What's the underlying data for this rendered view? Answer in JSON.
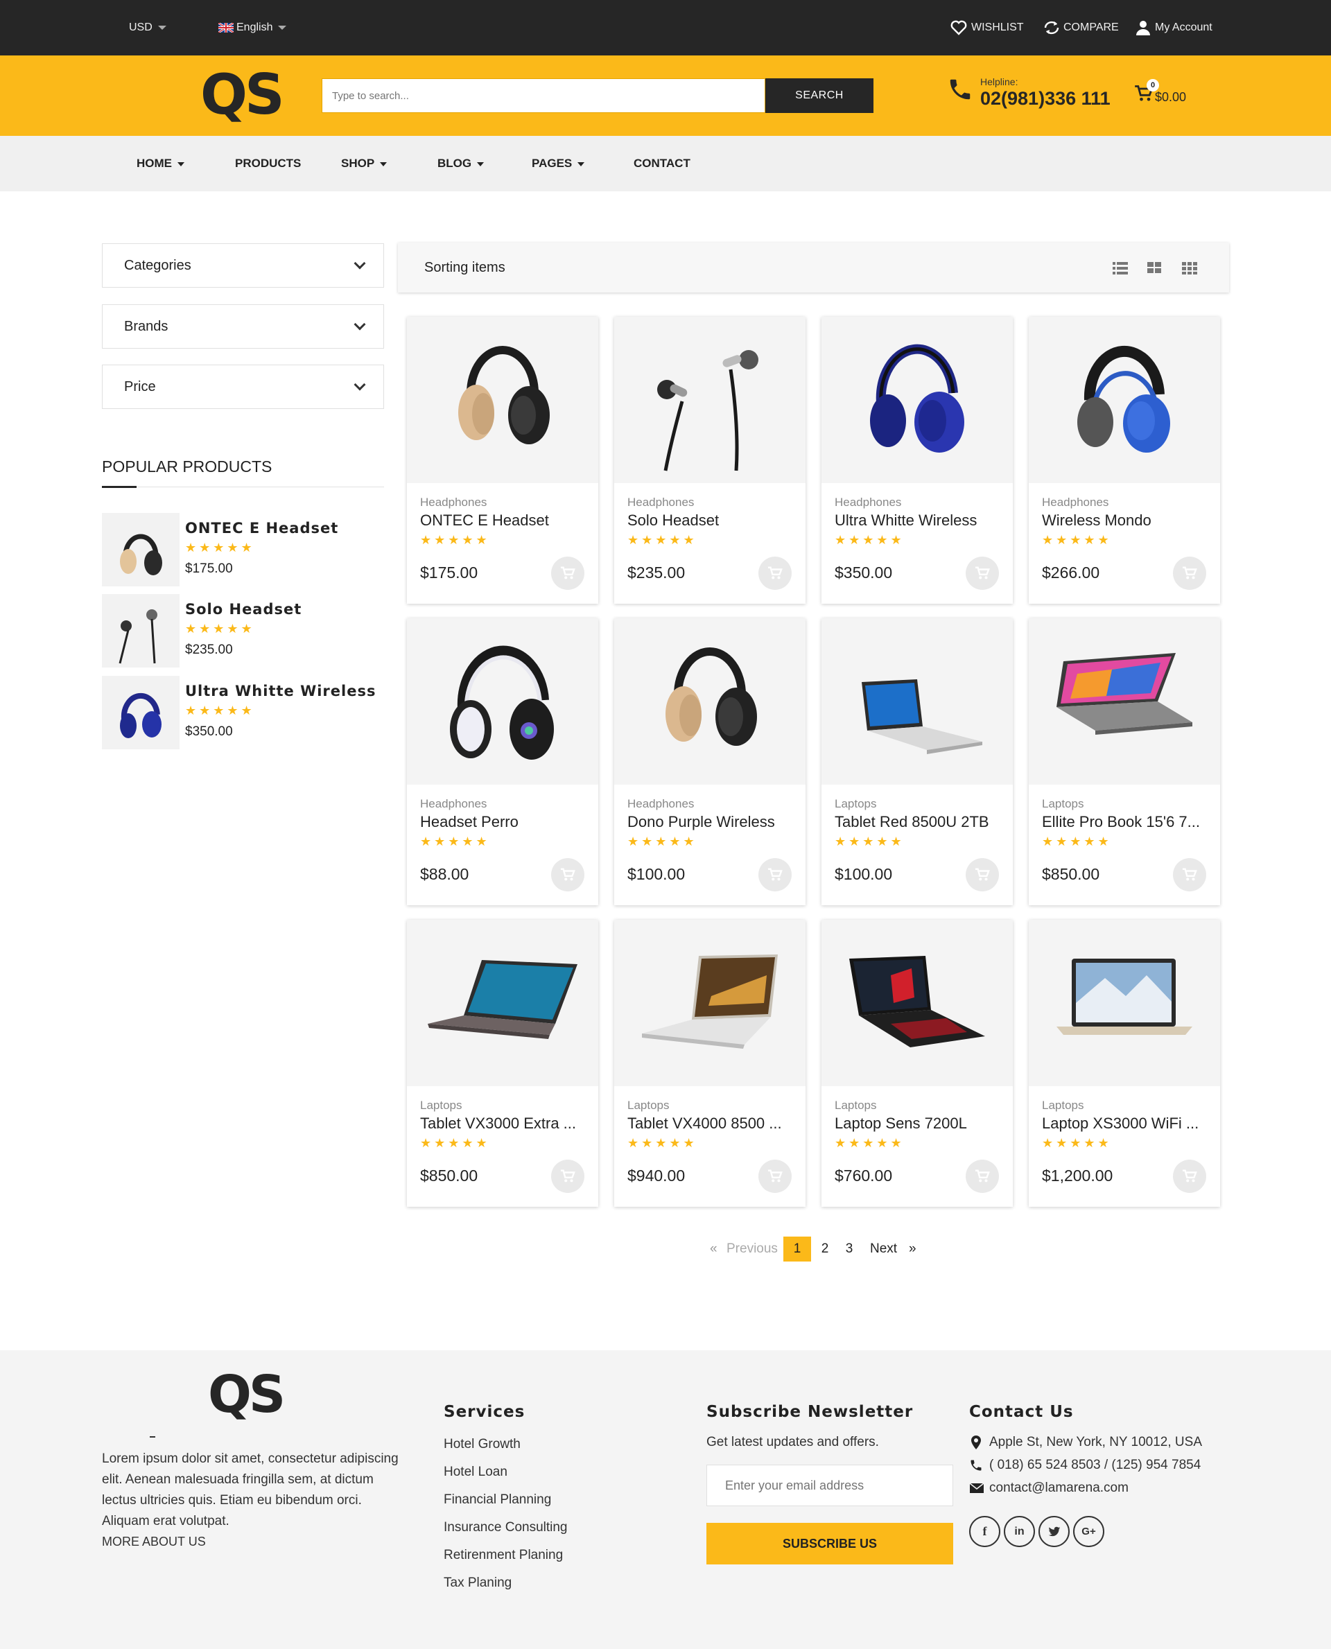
{
  "topbar": {
    "currency": "USD",
    "language": "English",
    "wishlist": "WISHLIST",
    "compare": "COMPARE",
    "account": "My Account"
  },
  "header": {
    "logo": "QS",
    "search_placeholder": "Type to search...",
    "search_button": "SEARCH",
    "helpline_label": "Helpline:",
    "helpline_number": "02(981)336 111",
    "cart_count": "0",
    "cart_total": "$0.00"
  },
  "nav": {
    "items": [
      {
        "label": "HOME"
      },
      {
        "label": "PRODUCTS"
      },
      {
        "label": "SHOP"
      },
      {
        "label": "BLOG"
      },
      {
        "label": "PAGES"
      },
      {
        "label": "CONTACT"
      }
    ]
  },
  "sidebar": {
    "filters": [
      "Categories",
      "Brands",
      "Price"
    ],
    "popular_title": "POPULAR PRODUCTS",
    "popular": [
      {
        "name": "ONTEC E Headset",
        "price": "$175.00",
        "stars": "★★★★★"
      },
      {
        "name": "Solo Headset",
        "price": "$235.00",
        "stars": "★★★★★"
      },
      {
        "name": "Ultra Whitte Wireless",
        "price": "$350.00",
        "stars": "★★★★★"
      }
    ]
  },
  "sortbar": {
    "label": "Sorting items"
  },
  "products": [
    {
      "category": "Headphones",
      "title": "ONTEC E Headset",
      "price": "$175.00",
      "stars": "★★★★★"
    },
    {
      "category": "Headphones",
      "title": "Solo Headset",
      "price": "$235.00",
      "stars": "★★★★★"
    },
    {
      "category": "Headphones",
      "title": "Ultra Whitte Wireless",
      "price": "$350.00",
      "stars": "★★★★★"
    },
    {
      "category": "Headphones",
      "title": "Wireless Mondo",
      "price": "$266.00",
      "stars": "★★★★★"
    },
    {
      "category": "Headphones",
      "title": "Headset Perro",
      "price": "$88.00",
      "stars": "★★★★★"
    },
    {
      "category": "Headphones",
      "title": "Dono Purple Wireless",
      "price": "$100.00",
      "stars": "★★★★★"
    },
    {
      "category": "Laptops",
      "title": "Tablet Red 8500U 2TB",
      "price": "$100.00",
      "stars": "★★★★★"
    },
    {
      "category": "Laptops",
      "title": "Ellite Pro Book 15'6 7...",
      "price": "$850.00",
      "stars": "★★★★★"
    },
    {
      "category": "Laptops",
      "title": "Tablet VX3000 Extra ...",
      "price": "$850.00",
      "stars": "★★★★★"
    },
    {
      "category": "Laptops",
      "title": "Tablet VX4000 8500 ...",
      "price": "$940.00",
      "stars": "★★★★★"
    },
    {
      "category": "Laptops",
      "title": "Laptop Sens 7200L",
      "price": "$760.00",
      "stars": "★★★★★"
    },
    {
      "category": "Laptops",
      "title": "Laptop XS3000 WiFi ...",
      "price": "$1,200.00",
      "stars": "★★★★★"
    }
  ],
  "pagination": {
    "prev_arrow": "«",
    "previous": "Previous",
    "pages": [
      "1",
      "2",
      "3"
    ],
    "current": "1",
    "next": "Next",
    "next_arrow": "»"
  },
  "footer": {
    "logo": "QS",
    "about_lines": [
      "Lorem ipsum dolor sit amet, consectetur adipiscing",
      "elit. Aenean malesuada fringilla sem, at dictum",
      "lectus ultricies quis. Etiam eu bibendum orci.",
      "Aliquam erat volutpat."
    ],
    "more_about": "MORE ABOUT US",
    "services_title": "Services",
    "services": [
      "Hotel Growth",
      "Hotel Loan",
      "Financial Planning",
      "Insurance Consulting",
      "Retirenment Planing",
      "Tax Planing"
    ],
    "newsletter_title": "Subscribe Newsletter",
    "newsletter_text": "Get latest updates and offers.",
    "email_placeholder": "Enter your email address",
    "subscribe_button": "SUBSCRIBE US",
    "contact_title": "Contact Us",
    "address": "Apple St, New York, NY 10012, USA",
    "phone": "( 018) 65 524 8503 / (125) 954 7854",
    "email": "contact@lamarena.com",
    "social": [
      "facebook-icon",
      "linkedin-icon",
      "twitter-icon",
      "google-plus-icon"
    ]
  },
  "colors": {
    "accent": "#fbb919",
    "dark": "#262626",
    "nav_bg": "#f0f0f0",
    "footer_bg": "#f4f4f4"
  }
}
